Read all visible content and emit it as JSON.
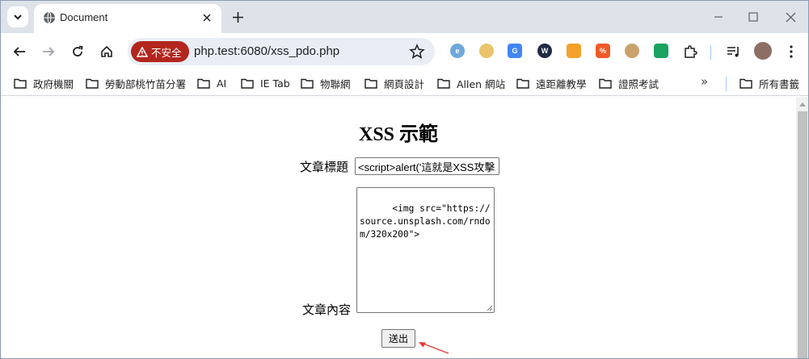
{
  "browser": {
    "tab_title": "Document",
    "url": "php.test:6080/xss_pdo.php",
    "security_chip": "不安全"
  },
  "bookmarks": [
    {
      "label": "政府機關"
    },
    {
      "label": "勞動部桃竹苗分署"
    },
    {
      "label": "AI"
    },
    {
      "label": "IE Tab"
    },
    {
      "label": "物聯網"
    },
    {
      "label": "網頁設計"
    },
    {
      "label": "Allen 網站"
    },
    {
      "label": "遠距離教學"
    },
    {
      "label": "證照考試"
    }
  ],
  "bookmarks_more": "»",
  "all_bookmarks": "所有書籤",
  "page": {
    "heading": "XSS 示範",
    "title_label": "文章標題",
    "title_value": "<script>alert('這就是XSS攻擊",
    "content_label": "文章內容",
    "content_value": "<img src=\"https://source.unsplash.com/rndom/320x200\">",
    "submit_label": "送出"
  },
  "colors": {
    "tabstrip": "#dee3ea",
    "omnibox": "#e9eef6",
    "warning_chip": "#b3261e",
    "arrow": "#e53935"
  }
}
